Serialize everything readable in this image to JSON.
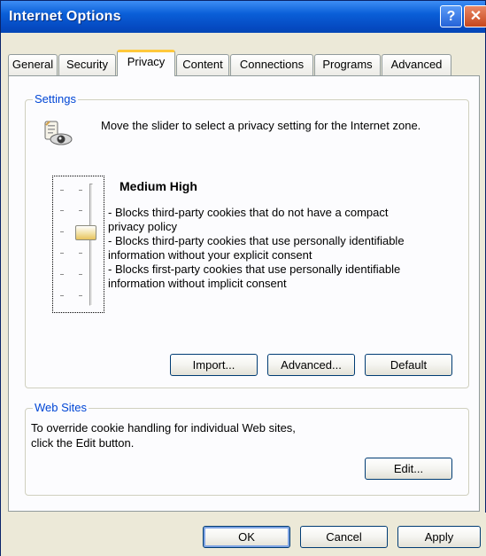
{
  "window": {
    "title": "Internet Options",
    "help_glyph": "?",
    "close_glyph": "✕"
  },
  "tabs": [
    {
      "label": "General"
    },
    {
      "label": "Security"
    },
    {
      "label": "Privacy"
    },
    {
      "label": "Content"
    },
    {
      "label": "Connections"
    },
    {
      "label": "Programs"
    },
    {
      "label": "Advanced"
    }
  ],
  "active_tab": "Privacy",
  "settings": {
    "group_label": "Settings",
    "intro": "Move the slider to select a privacy setting for the Internet zone.",
    "slider_level_index": 2,
    "slider_level_count": 6,
    "level_name": "Medium High",
    "level_lines": [
      "- Blocks third-party cookies that do not have a compact",
      "privacy policy",
      "- Blocks third-party cookies that use personally identifiable",
      "information without your explicit consent",
      "- Blocks first-party cookies that use personally identifiable",
      "information without implicit consent"
    ],
    "import_label": "Import...",
    "advanced_label": "Advanced...",
    "default_label": "Default"
  },
  "websites": {
    "group_label": "Web Sites",
    "line1": "To override cookie handling for individual Web sites,",
    "line2": "click the Edit button.",
    "edit_label": "Edit..."
  },
  "footer": {
    "ok_label": "OK",
    "cancel_label": "Cancel",
    "apply_label": "Apply"
  },
  "colors": {
    "titlebar": "#0a5fd8",
    "group_label": "#0046d5",
    "active_tab_accent": "#ffc83c",
    "window_bg": "#ece9d8"
  }
}
